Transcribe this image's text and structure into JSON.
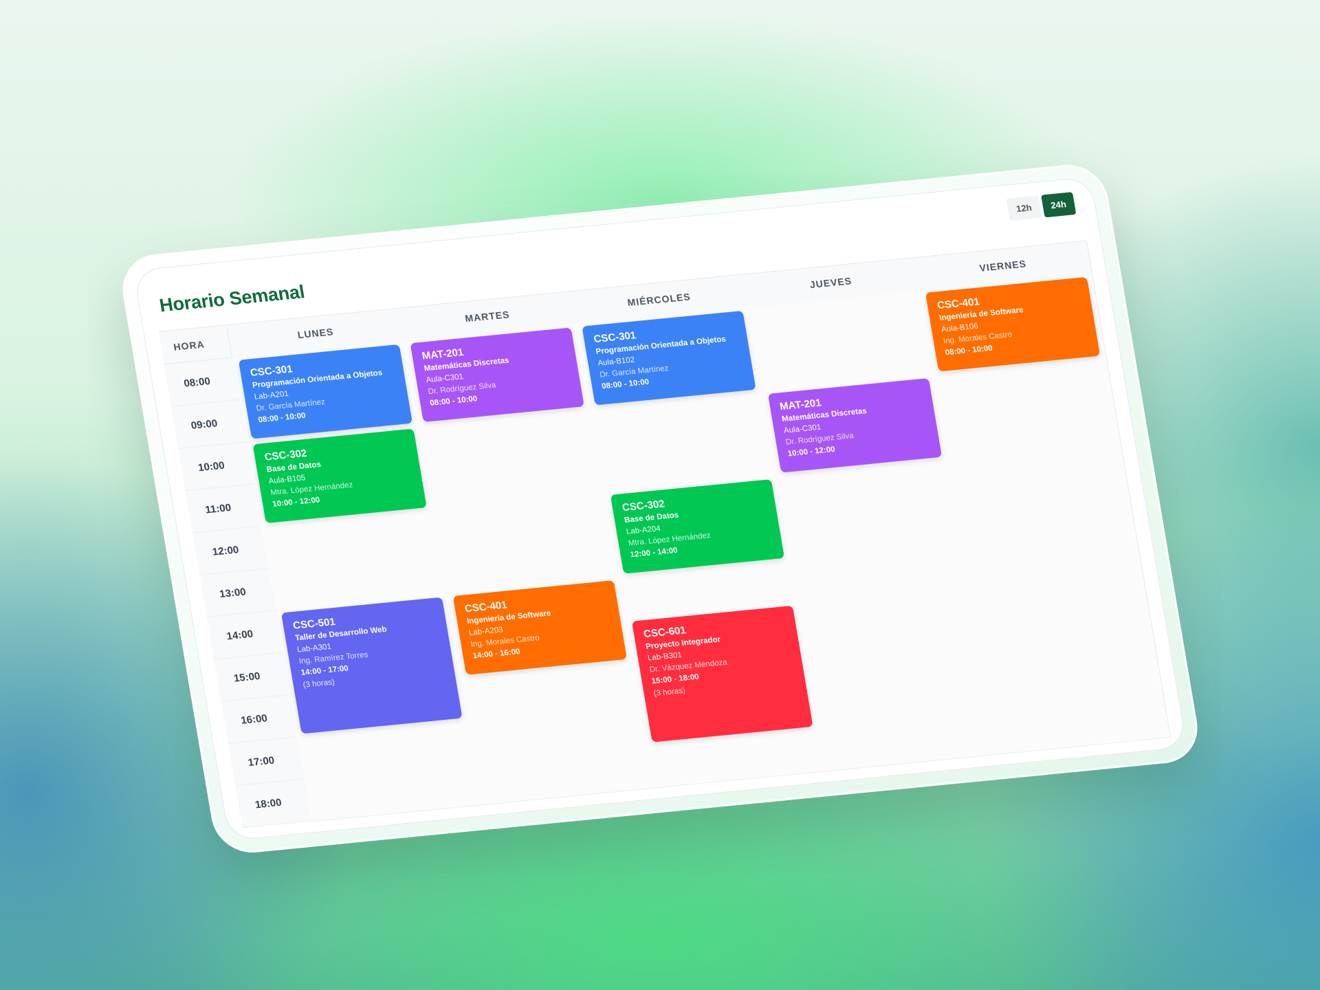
{
  "title": "Horario Semanal",
  "toggle": {
    "opt12": "12h",
    "opt24": "24h",
    "active": "24h"
  },
  "headers": {
    "hora": "HORA",
    "days": [
      "LUNES",
      "MARTES",
      "MIÉRCOLES",
      "JUEVES",
      "VIERNES"
    ]
  },
  "times": [
    "08:00",
    "09:00",
    "10:00",
    "11:00",
    "12:00",
    "13:00",
    "14:00",
    "15:00",
    "16:00",
    "17:00",
    "18:00"
  ],
  "colors": {
    "blue": "#3b82f6",
    "purple": "#a855f7",
    "green": "#00c853",
    "orange": "#ff6d00",
    "indigo": "#6366f1",
    "red": "#ff2d3d",
    "title": "#0f6b3c",
    "toggle_active": "#14613a"
  },
  "events": [
    {
      "day": 0,
      "code": "CSC-301",
      "course": "Programación Orientada a Objetos",
      "room": "Lab-A201",
      "prof": "Dr. García Martínez",
      "time": "08:00 - 10:00",
      "duration_label": "",
      "start": 8,
      "end": 10,
      "color": "blue"
    },
    {
      "day": 0,
      "code": "CSC-302",
      "course": "Base de Datos",
      "room": "Aula-B105",
      "prof": "Mtra. López Hernández",
      "time": "10:00 - 12:00",
      "duration_label": "",
      "start": 10,
      "end": 12,
      "color": "green"
    },
    {
      "day": 0,
      "code": "CSC-501",
      "course": "Taller de Desarrollo Web",
      "room": "Lab-A301",
      "prof": "Ing. Ramírez Torres",
      "time": "14:00 - 17:00",
      "duration_label": "(3 horas)",
      "start": 14,
      "end": 17,
      "color": "indigo"
    },
    {
      "day": 1,
      "code": "MAT-201",
      "course": "Matemáticas Discretas",
      "room": "Aula-C301",
      "prof": "Dr. Rodríguez Silva",
      "time": "08:00 - 10:00",
      "duration_label": "",
      "start": 8,
      "end": 10,
      "color": "purple"
    },
    {
      "day": 1,
      "code": "CSC-401",
      "course": "Ingeniería de Software",
      "room": "Lab-A203",
      "prof": "Ing. Morales Castro",
      "time": "14:00 - 16:00",
      "duration_label": "",
      "start": 14,
      "end": 16,
      "color": "orange"
    },
    {
      "day": 2,
      "code": "CSC-301",
      "course": "Programación Orientada a Objetos",
      "room": "Aula-B102",
      "prof": "Dr. García Martínez",
      "time": "08:00 - 10:00",
      "duration_label": "",
      "start": 8,
      "end": 10,
      "color": "blue"
    },
    {
      "day": 2,
      "code": "CSC-302",
      "course": "Base de Datos",
      "room": "Lab-A204",
      "prof": "Mtra. López Hernández",
      "time": "12:00 - 14:00",
      "duration_label": "",
      "start": 12,
      "end": 14,
      "color": "green"
    },
    {
      "day": 2,
      "code": "CSC-601",
      "course": "Proyecto Integrador",
      "room": "Lab-B301",
      "prof": "Dr. Vázquez Mendoza",
      "time": "15:00 - 18:00",
      "duration_label": "(3 horas)",
      "start": 15,
      "end": 18,
      "color": "red"
    },
    {
      "day": 3,
      "code": "MAT-201",
      "course": "Matemáticas Discretas",
      "room": "Aula-C301",
      "prof": "Dr. Rodríguez Silva",
      "time": "10:00 - 12:00",
      "duration_label": "",
      "start": 10,
      "end": 12,
      "color": "purple"
    },
    {
      "day": 4,
      "code": "CSC-401",
      "course": "Ingeniería de Software",
      "room": "Aula-B106",
      "prof": "Ing. Morales Castro",
      "time": "08:00 - 10:00",
      "duration_label": "",
      "start": 8,
      "end": 10,
      "color": "orange"
    }
  ]
}
